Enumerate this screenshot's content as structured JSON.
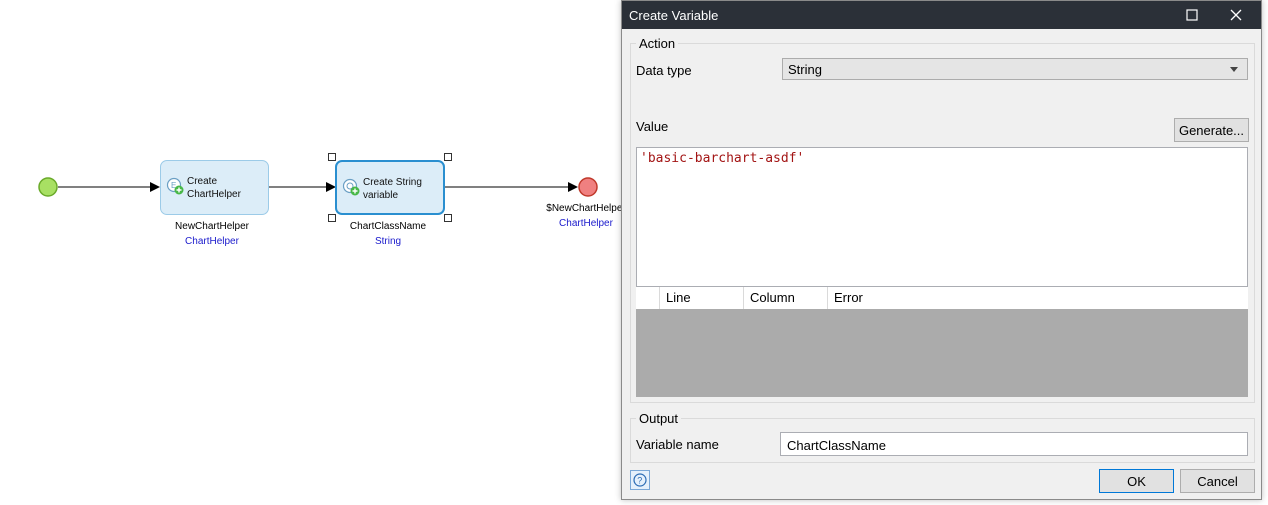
{
  "flow": {
    "start_event": "start-event",
    "activities": [
      {
        "title": "Create ChartHelper",
        "line1": "Create",
        "line2": "ChartHelper",
        "output_name": "NewChartHelper",
        "output_type": "ChartHelper"
      },
      {
        "title": "Create String variable",
        "line1": "Create String",
        "line2": "variable",
        "output_name": "ChartClassName",
        "output_type": "String"
      }
    ],
    "end_event": {
      "return_value": "$NewChartHelper",
      "return_type": "ChartHelper"
    }
  },
  "dialog": {
    "title": "Create Variable",
    "action_group": "Action",
    "data_type_label": "Data type",
    "data_type_value": "String",
    "value_label": "Value",
    "generate_button": "Generate...",
    "expression": "'basic-barchart-asdf'",
    "error_columns": [
      "Line",
      "Column",
      "Error"
    ],
    "output_group": "Output",
    "variable_name_label": "Variable name",
    "variable_name_value": "ChartClassName",
    "ok_button": "OK",
    "cancel_button": "Cancel"
  },
  "colors": {
    "start_event": "#a8e063",
    "end_event": "#f08080",
    "activity_fill": "#dcedf8",
    "activity_border_selected": "#2a8fd0",
    "type_text": "#1a1acc",
    "string_literal": "#a31515",
    "titlebar": "#2b3038"
  }
}
